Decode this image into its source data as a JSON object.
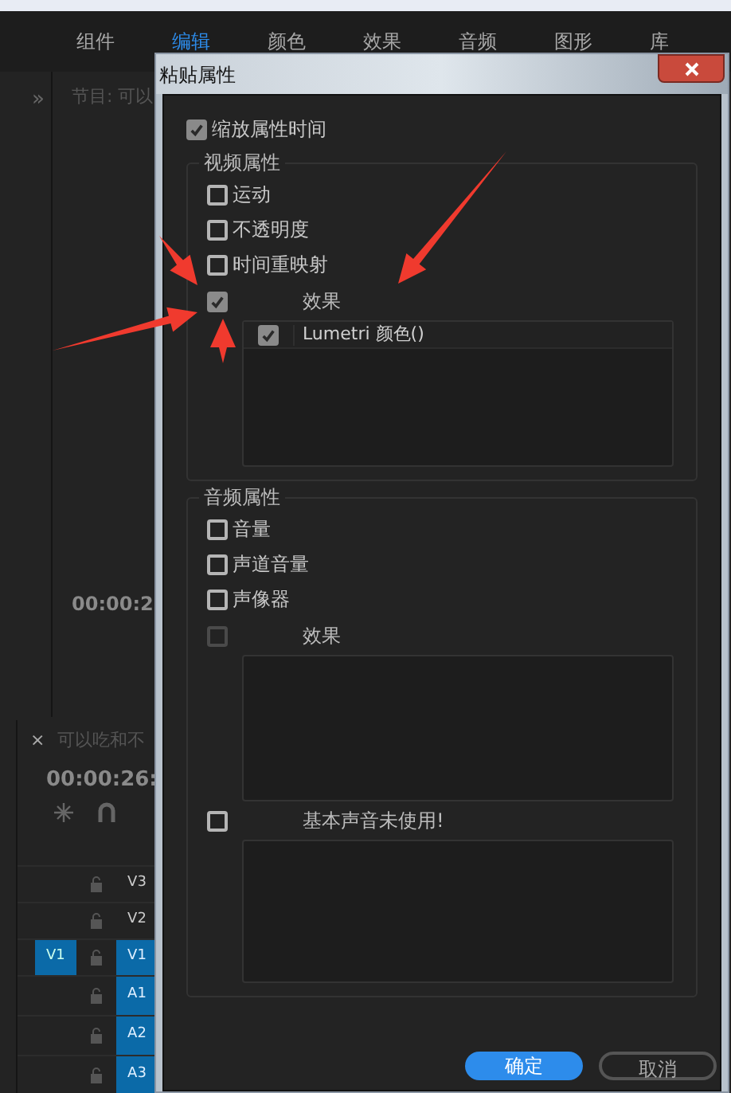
{
  "app_tabs": [
    {
      "label": "组件",
      "selected": false
    },
    {
      "label": "编辑",
      "selected": true
    },
    {
      "label": "颜色",
      "selected": false
    },
    {
      "label": "效果",
      "selected": false
    },
    {
      "label": "音频",
      "selected": false
    },
    {
      "label": "图形",
      "selected": false
    },
    {
      "label": "库",
      "selected": false
    }
  ],
  "program_panel": {
    "expand": "»",
    "title": "节目: 可以",
    "timecode": "00:00:2"
  },
  "timeline": {
    "close": "×",
    "title": "可以吃和不",
    "timecode": "00:00:26:",
    "tracks": [
      {
        "label": "V3",
        "targeted": false
      },
      {
        "label": "V2",
        "targeted": false
      },
      {
        "label": "V1",
        "targeted": true,
        "source": "V1"
      },
      {
        "label": "A1",
        "targeted": true
      },
      {
        "label": "A2",
        "targeted": true
      },
      {
        "label": "A3",
        "targeted": true
      }
    ]
  },
  "dialog": {
    "title": "粘贴属性",
    "scale_time": {
      "label": "缩放属性时间",
      "checked": true
    },
    "video_group": {
      "title": "视频属性",
      "items": [
        {
          "label": "运动",
          "checked": false
        },
        {
          "label": "不透明度",
          "checked": false
        },
        {
          "label": "时间重映射",
          "checked": false
        }
      ],
      "effects": {
        "header": "效果",
        "checked": true,
        "disabled": false,
        "list": [
          {
            "label": "Lumetri 颜色()",
            "checked": true
          }
        ]
      }
    },
    "audio_group": {
      "title": "音频属性",
      "items": [
        {
          "label": "音量",
          "checked": false
        },
        {
          "label": "声道音量",
          "checked": false
        },
        {
          "label": "声像器",
          "checked": false
        }
      ],
      "effects": {
        "header": "效果",
        "checked": false,
        "disabled": true
      },
      "essential_sound": {
        "header": "基本声音未使用!",
        "checked": false,
        "disabled": false
      }
    },
    "buttons": [
      {
        "label": "确定",
        "kind": "primary"
      },
      {
        "label": "取消",
        "kind": "secondary"
      }
    ]
  }
}
